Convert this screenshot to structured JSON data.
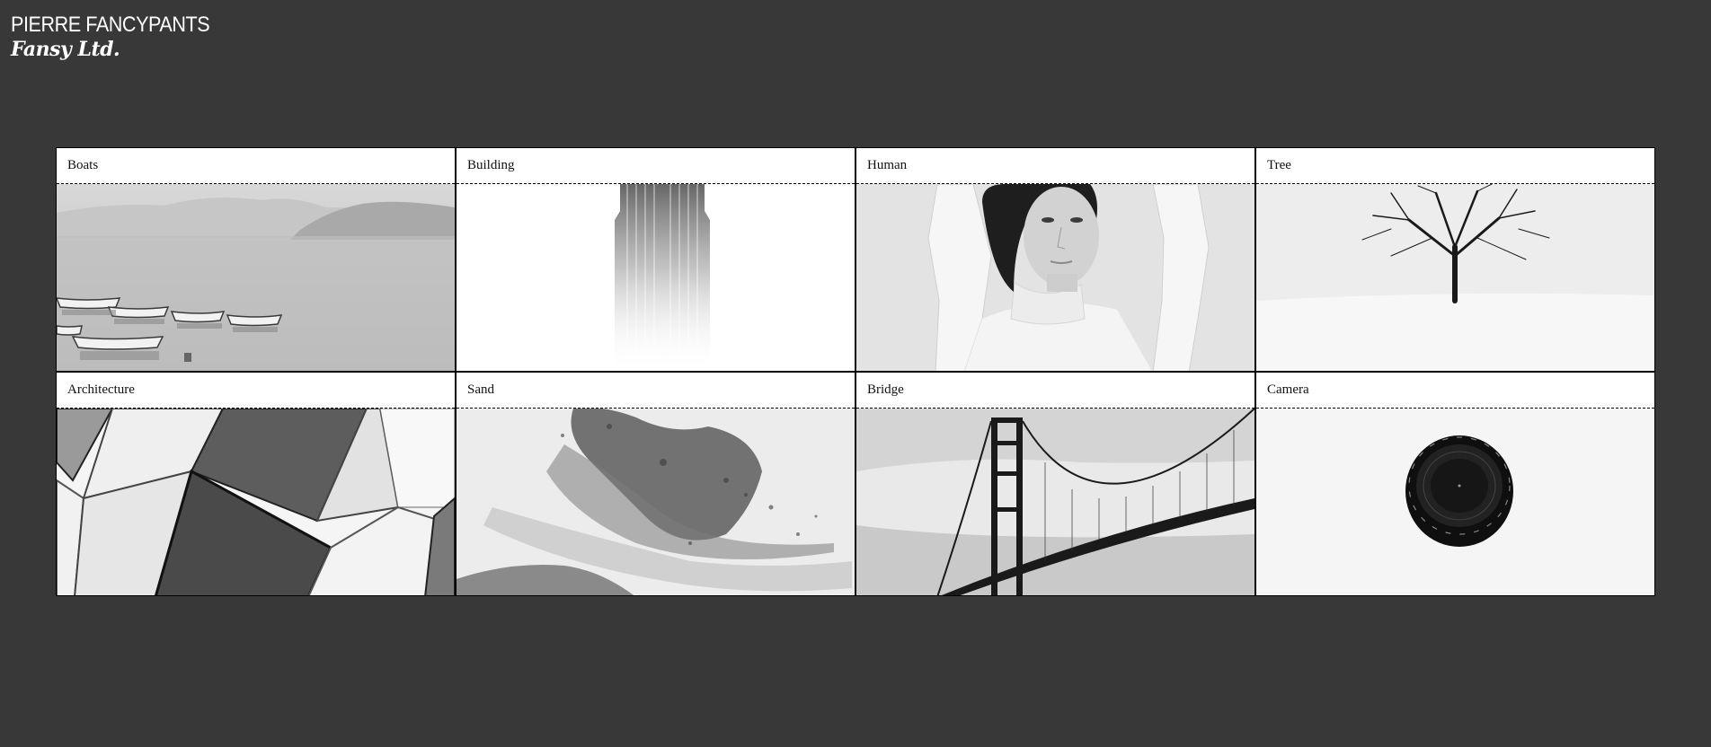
{
  "brand": {
    "name": "PIERRE FANCYPANTS",
    "subtitle": "Fansy Ltd."
  },
  "gallery": {
    "items": [
      {
        "label": "Boats",
        "icon": "boats-photo"
      },
      {
        "label": "Building",
        "icon": "building-photo"
      },
      {
        "label": "Human",
        "icon": "human-photo"
      },
      {
        "label": "Tree",
        "icon": "tree-photo"
      },
      {
        "label": "Architecture",
        "icon": "architecture-photo"
      },
      {
        "label": "Sand",
        "icon": "sand-photo"
      },
      {
        "label": "Bridge",
        "icon": "bridge-photo"
      },
      {
        "label": "Camera",
        "icon": "camera-lens-photo"
      }
    ]
  },
  "colors": {
    "background": "#383838",
    "card": "#ffffff",
    "border": "#000000"
  }
}
